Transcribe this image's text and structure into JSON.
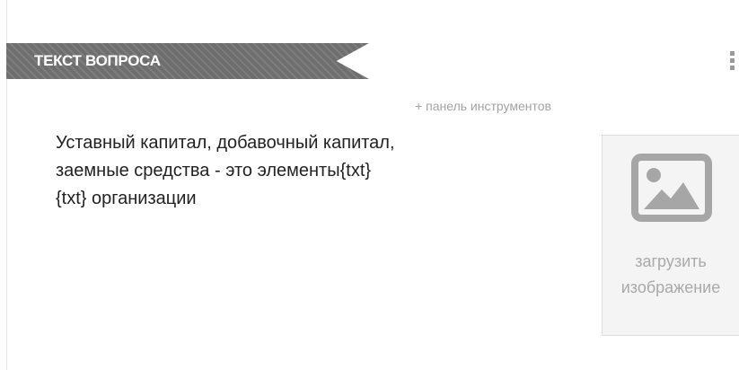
{
  "question": {
    "header_title": "ТЕКСТ ВОПРОСА",
    "toolbar_link": "+ панель инструментов",
    "text": "Уставный капитал, добавочный капитал,\nзаемные средства - это элементы{txt}\n{txt} организации"
  },
  "image_upload": {
    "label": "загрузить\nизображение",
    "icon": "image-icon"
  },
  "menu": {
    "icon": "kebab-menu-icon"
  },
  "colors": {
    "ribbon": "#6e6e6e",
    "text": "#222222",
    "muted": "#a3a3a3",
    "upload_bg": "#f4f4f4"
  }
}
